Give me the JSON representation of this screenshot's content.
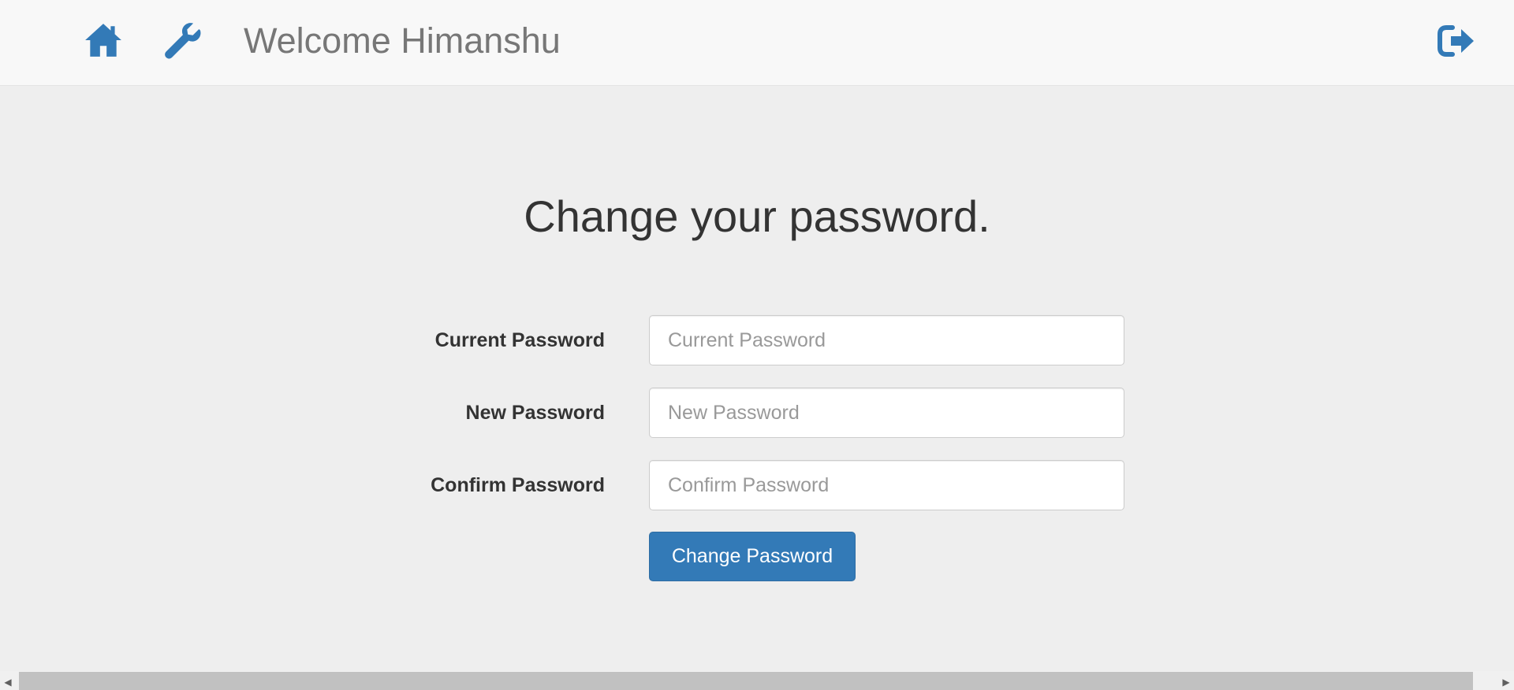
{
  "header": {
    "welcome_text": "Welcome Himanshu",
    "icons": [
      "home-icon",
      "wrench-icon",
      "logout-icon"
    ],
    "icon_color": "#337ab7"
  },
  "main": {
    "title": "Change your password.",
    "fields": [
      {
        "label": "Current Password",
        "placeholder": "Current Password",
        "value": ""
      },
      {
        "label": "New Password",
        "placeholder": "New Password",
        "value": ""
      },
      {
        "label": "Confirm Password",
        "placeholder": "Confirm Password",
        "value": ""
      }
    ],
    "submit_label": "Change Password"
  },
  "colors": {
    "primary": "#337ab7",
    "page_background": "#eeeeee",
    "navbar_background": "#f8f8f8"
  }
}
